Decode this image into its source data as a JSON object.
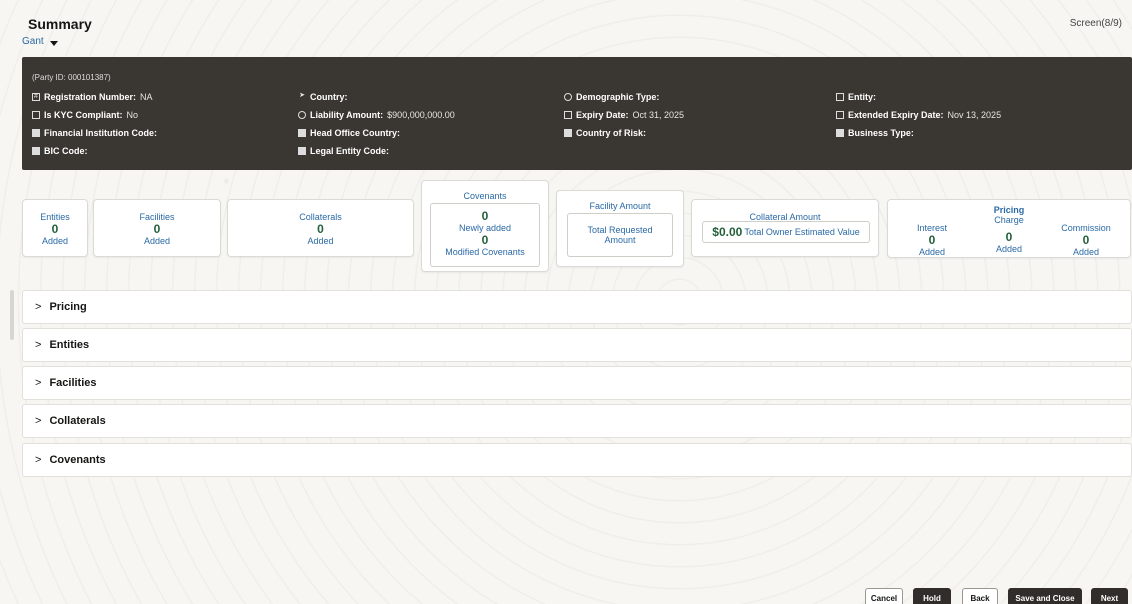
{
  "header": {
    "title": "Summary",
    "subtitle": "Gant",
    "screen": "Screen(8/9)"
  },
  "infobar": {
    "party_id": "(Party ID: 000101387)",
    "items": [
      {
        "icon": "hash-icon",
        "label": "Registration Number:",
        "value": "NA"
      },
      {
        "icon": "send-icon",
        "label": "Country:",
        "value": ""
      },
      {
        "icon": "location-pin-icon",
        "label": "Demographic Type:",
        "value": ""
      },
      {
        "icon": "entity-icon",
        "label": "Entity:",
        "value": ""
      },
      {
        "icon": "id-card-icon",
        "label": "Is KYC Compliant:",
        "value": "No"
      },
      {
        "icon": "money-bag-icon",
        "label": "Liability Amount:",
        "value": "$900,000,000.00"
      },
      {
        "icon": "calendar-icon",
        "label": "Expiry Date:",
        "value": "Oct 31, 2025"
      },
      {
        "icon": "calendar-icon",
        "label": "Extended Expiry Date:",
        "value": "Nov 13, 2025"
      },
      {
        "icon": "building-icon",
        "label": "Financial Institution Code:",
        "value": ""
      },
      {
        "icon": "building-icon",
        "label": "Head Office Country:",
        "value": ""
      },
      {
        "icon": "building-icon",
        "label": "Country of Risk:",
        "value": ""
      },
      {
        "icon": "building-icon",
        "label": "Business Type:",
        "value": ""
      },
      {
        "icon": "building-icon",
        "label": "BIC Code:",
        "value": ""
      },
      {
        "icon": "building-icon",
        "label": "Legal Entity Code:",
        "value": ""
      }
    ]
  },
  "cards": {
    "entities": {
      "caption": "Entities",
      "count": "0",
      "sub": "Added"
    },
    "facilities": {
      "caption": "Facilities",
      "count": "0",
      "sub": "Added"
    },
    "collaterals": {
      "caption": "Collaterals",
      "count": "0",
      "sub": "Added"
    },
    "covenants": {
      "caption": "Covenants",
      "count1": "0",
      "sub1": "Newly added",
      "count2": "0",
      "sub2": "Modified Covenants"
    },
    "facility_amount": {
      "caption": "Facility Amount",
      "sub": "Total Requested Amount"
    },
    "collateral_amount": {
      "caption": "Collateral Amount",
      "value": "$0.00",
      "sub": "Total Owner Estimated Value"
    },
    "pricing": {
      "caption": "Pricing",
      "cols": [
        {
          "caption": "Interest",
          "count": "0",
          "sub": "Added"
        },
        {
          "caption": "Charge",
          "count": "0",
          "sub": "Added"
        },
        {
          "caption": "Commission",
          "count": "0",
          "sub": "Added"
        }
      ]
    }
  },
  "sections": [
    "Pricing",
    "Entities",
    "Facilities",
    "Collaterals",
    "Covenants"
  ],
  "footer": {
    "cancel": "Cancel",
    "hold": "Hold",
    "back": "Back",
    "save_close": "Save and Close",
    "next": "Next"
  }
}
